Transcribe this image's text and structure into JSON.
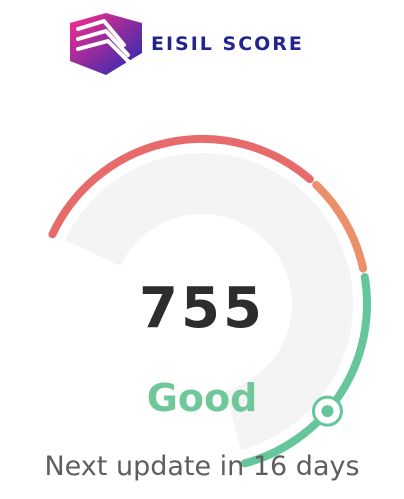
{
  "brand": {
    "name": "EISIL SCORE",
    "logo_icon": "layered-chevron-logo",
    "colors": {
      "text": "#24248f",
      "gradient_start": "#ff2d8a",
      "gradient_end": "#1e2bb3"
    }
  },
  "score": {
    "value": "755",
    "rating": "Good",
    "gauge_fraction": 0.85,
    "colors": {
      "low": "#e86b6b",
      "mid": "#eb9068",
      "high": "#66c69b",
      "track": "#f4f4f4"
    }
  },
  "footer": {
    "update_text": "Next update in 16 days"
  }
}
